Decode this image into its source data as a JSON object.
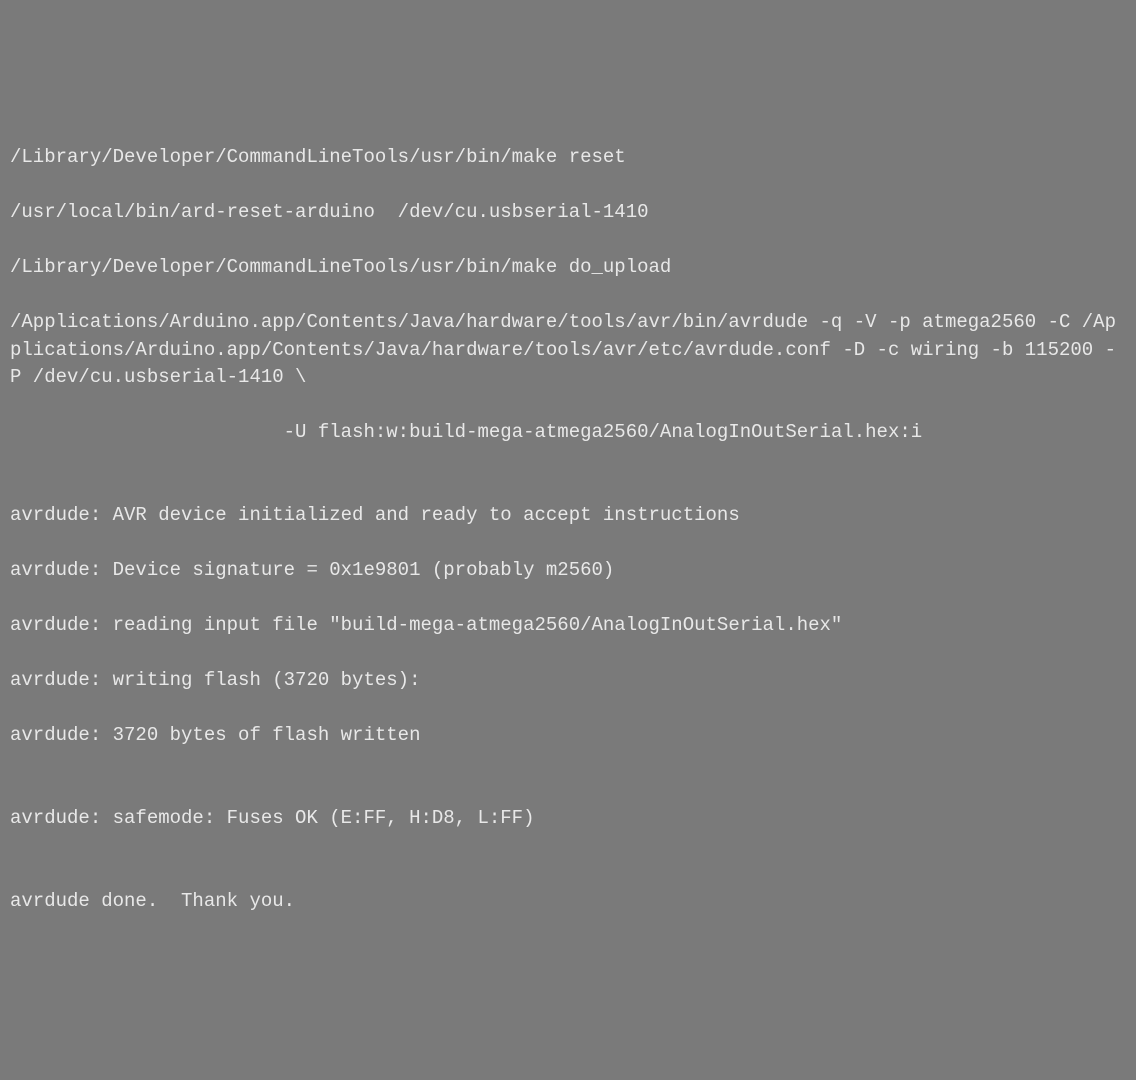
{
  "terminal": {
    "lines": [
      "/Library/Developer/CommandLineTools/usr/bin/make reset",
      "/usr/local/bin/ard-reset-arduino  /dev/cu.usbserial-1410",
      "/Library/Developer/CommandLineTools/usr/bin/make do_upload",
      "/Applications/Arduino.app/Contents/Java/hardware/tools/avr/bin/avrdude -q -V -p atmega2560 -C /Applications/Arduino.app/Contents/Java/hardware/tools/avr/etc/avrdude.conf -D -c wiring -b 115200 -P /dev/cu.usbserial-1410 \\",
      "                        -U flash:w:build-mega-atmega2560/AnalogInOutSerial.hex:i",
      "",
      "avrdude: AVR device initialized and ready to accept instructions",
      "avrdude: Device signature = 0x1e9801 (probably m2560)",
      "avrdude: reading input file \"build-mega-atmega2560/AnalogInOutSerial.hex\"",
      "avrdude: writing flash (3720 bytes):",
      "avrdude: 3720 bytes of flash written",
      "",
      "avrdude: safemode: Fuses OK (E:FF, H:D8, L:FF)",
      "",
      "avrdude done.  Thank you."
    ]
  }
}
